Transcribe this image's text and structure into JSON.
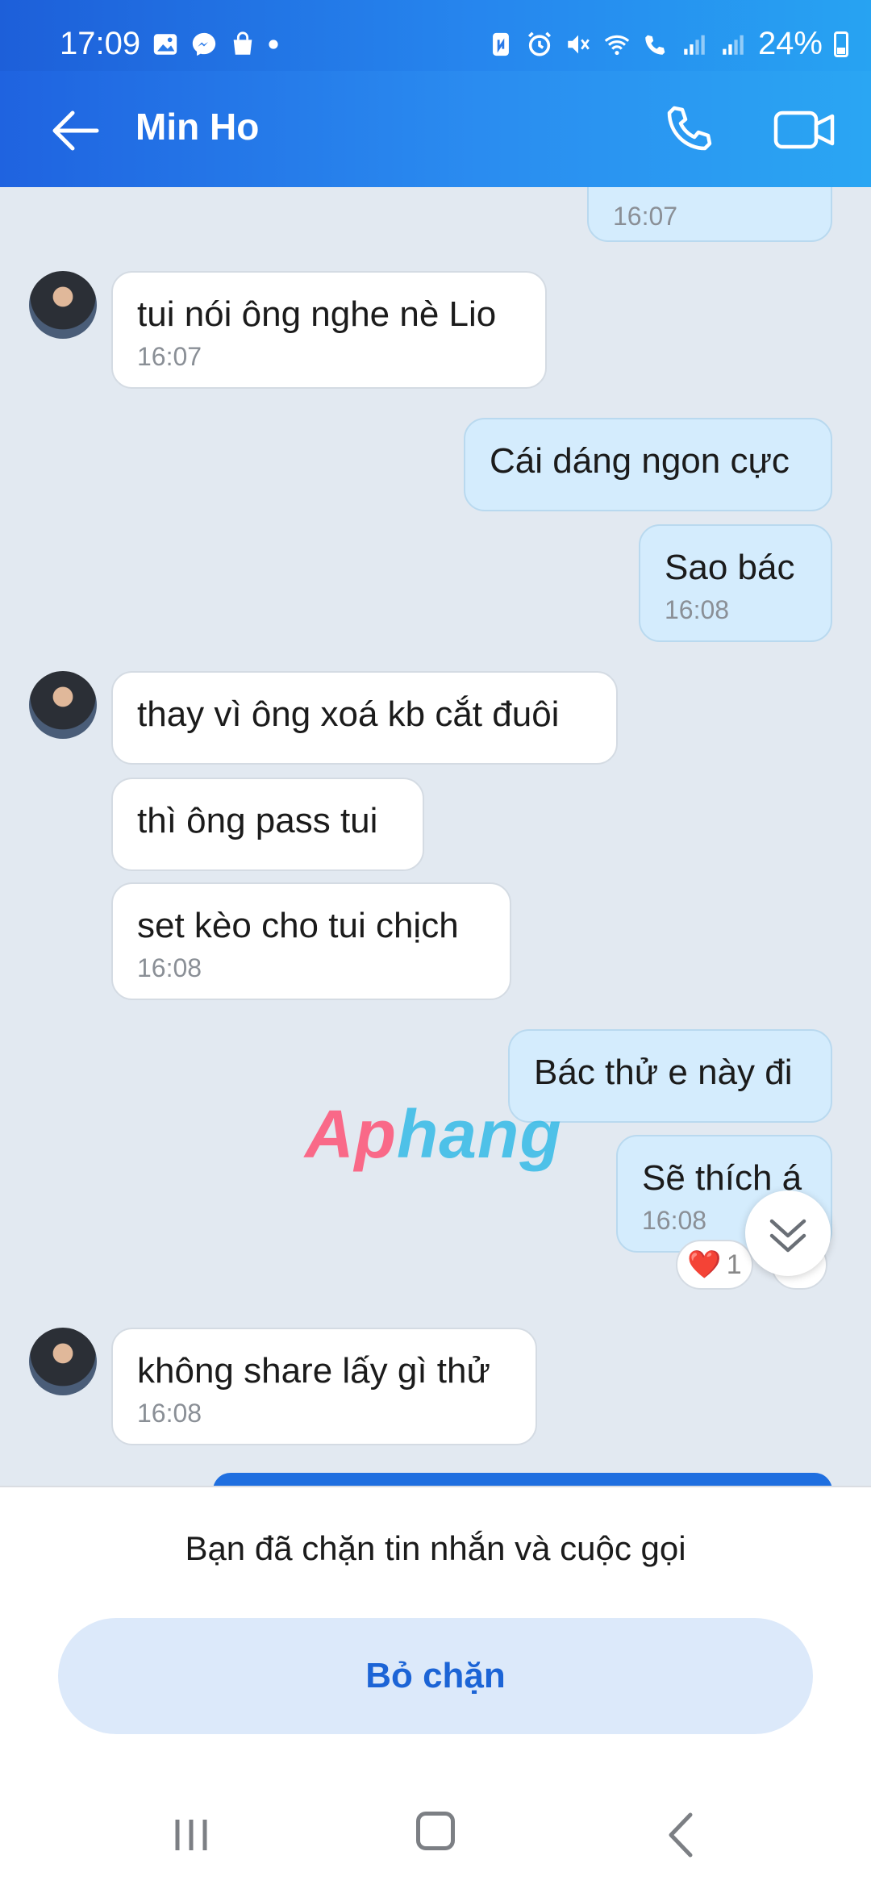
{
  "status_bar": {
    "time": "17:09",
    "battery": "24%"
  },
  "header": {
    "contact_name": "Min Ho"
  },
  "messages": [
    {
      "id": "m0",
      "dir": "out",
      "text": "",
      "time": "16:07"
    },
    {
      "id": "m1",
      "dir": "in",
      "text": "tui nói ông nghe nè Lio",
      "time": "16:07"
    },
    {
      "id": "m2",
      "dir": "out",
      "text": "Cái dáng ngon cực",
      "time": ""
    },
    {
      "id": "m3",
      "dir": "out",
      "text": "Sao bác",
      "time": "16:08"
    },
    {
      "id": "m4",
      "dir": "in",
      "text": "thay vì ông xoá kb cắt đuôi",
      "time": ""
    },
    {
      "id": "m5",
      "dir": "in",
      "text": "thì ông pass tui",
      "time": ""
    },
    {
      "id": "m6",
      "dir": "in",
      "text": "set kèo cho tui chịch",
      "time": "16:08"
    },
    {
      "id": "m7",
      "dir": "out",
      "text": "Bác thử e này đi",
      "time": ""
    },
    {
      "id": "m8",
      "dir": "out",
      "text": "Sẽ thích á",
      "time": "16:08"
    },
    {
      "id": "m9",
      "dir": "in",
      "text": "không share lấy gì thử",
      "time": "16:08"
    }
  ],
  "reaction": {
    "emoji": "❤️",
    "count": "1"
  },
  "watermark": {
    "part1": "Ap",
    "part2": "hang"
  },
  "blocked": {
    "notice": "Bạn đã chặn tin nhắn và cuộc gọi",
    "unblock_label": "Bỏ chặn"
  },
  "colors": {
    "header_start": "#1f63e0",
    "header_end": "#2aa6f3",
    "chat_bg": "#e2e9f1",
    "outgoing_bubble": "#d4ecfd",
    "incoming_bubble": "#ffffff",
    "accent": "#1c64d6"
  }
}
